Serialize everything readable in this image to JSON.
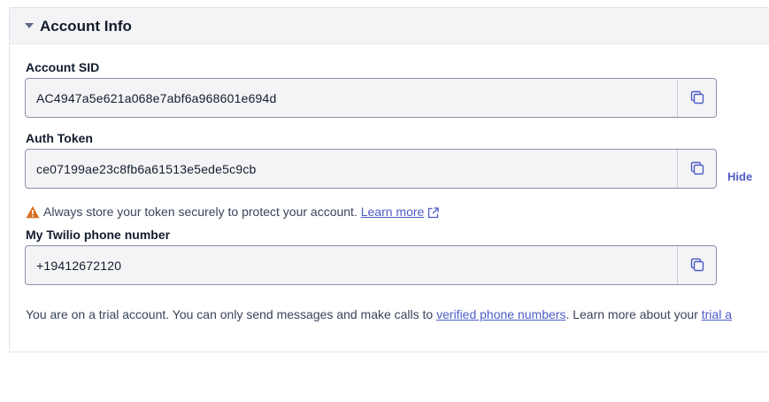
{
  "panel": {
    "title": "Account Info"
  },
  "account_sid": {
    "label": "Account SID",
    "value": "AC4947a5e621a068e7abf6a968601e694d"
  },
  "auth_token": {
    "label": "Auth Token",
    "value": "ce07199ae23c8fb6a61513e5ede5c9cb",
    "hide_label": "Hide"
  },
  "warning": {
    "text": "Always store your token securely to protect your account.",
    "link": "Learn more"
  },
  "phone": {
    "label": "My Twilio phone number",
    "value": "+19412672120"
  },
  "trial": {
    "text_before": "You are on a trial account. You can only send messages and make calls to",
    "link_verified": "verified phone numbers",
    "text_after": ". Learn more about your",
    "link_trial": "trial a"
  },
  "colors": {
    "accent": "#4c5cc7",
    "warning": "#d66f23",
    "field_bg": "#f4f4f6"
  },
  "icons": {
    "caret": "caret-down-icon",
    "copy": "copy-icon",
    "warning": "warning-triangle-icon",
    "external": "external-link-icon"
  }
}
